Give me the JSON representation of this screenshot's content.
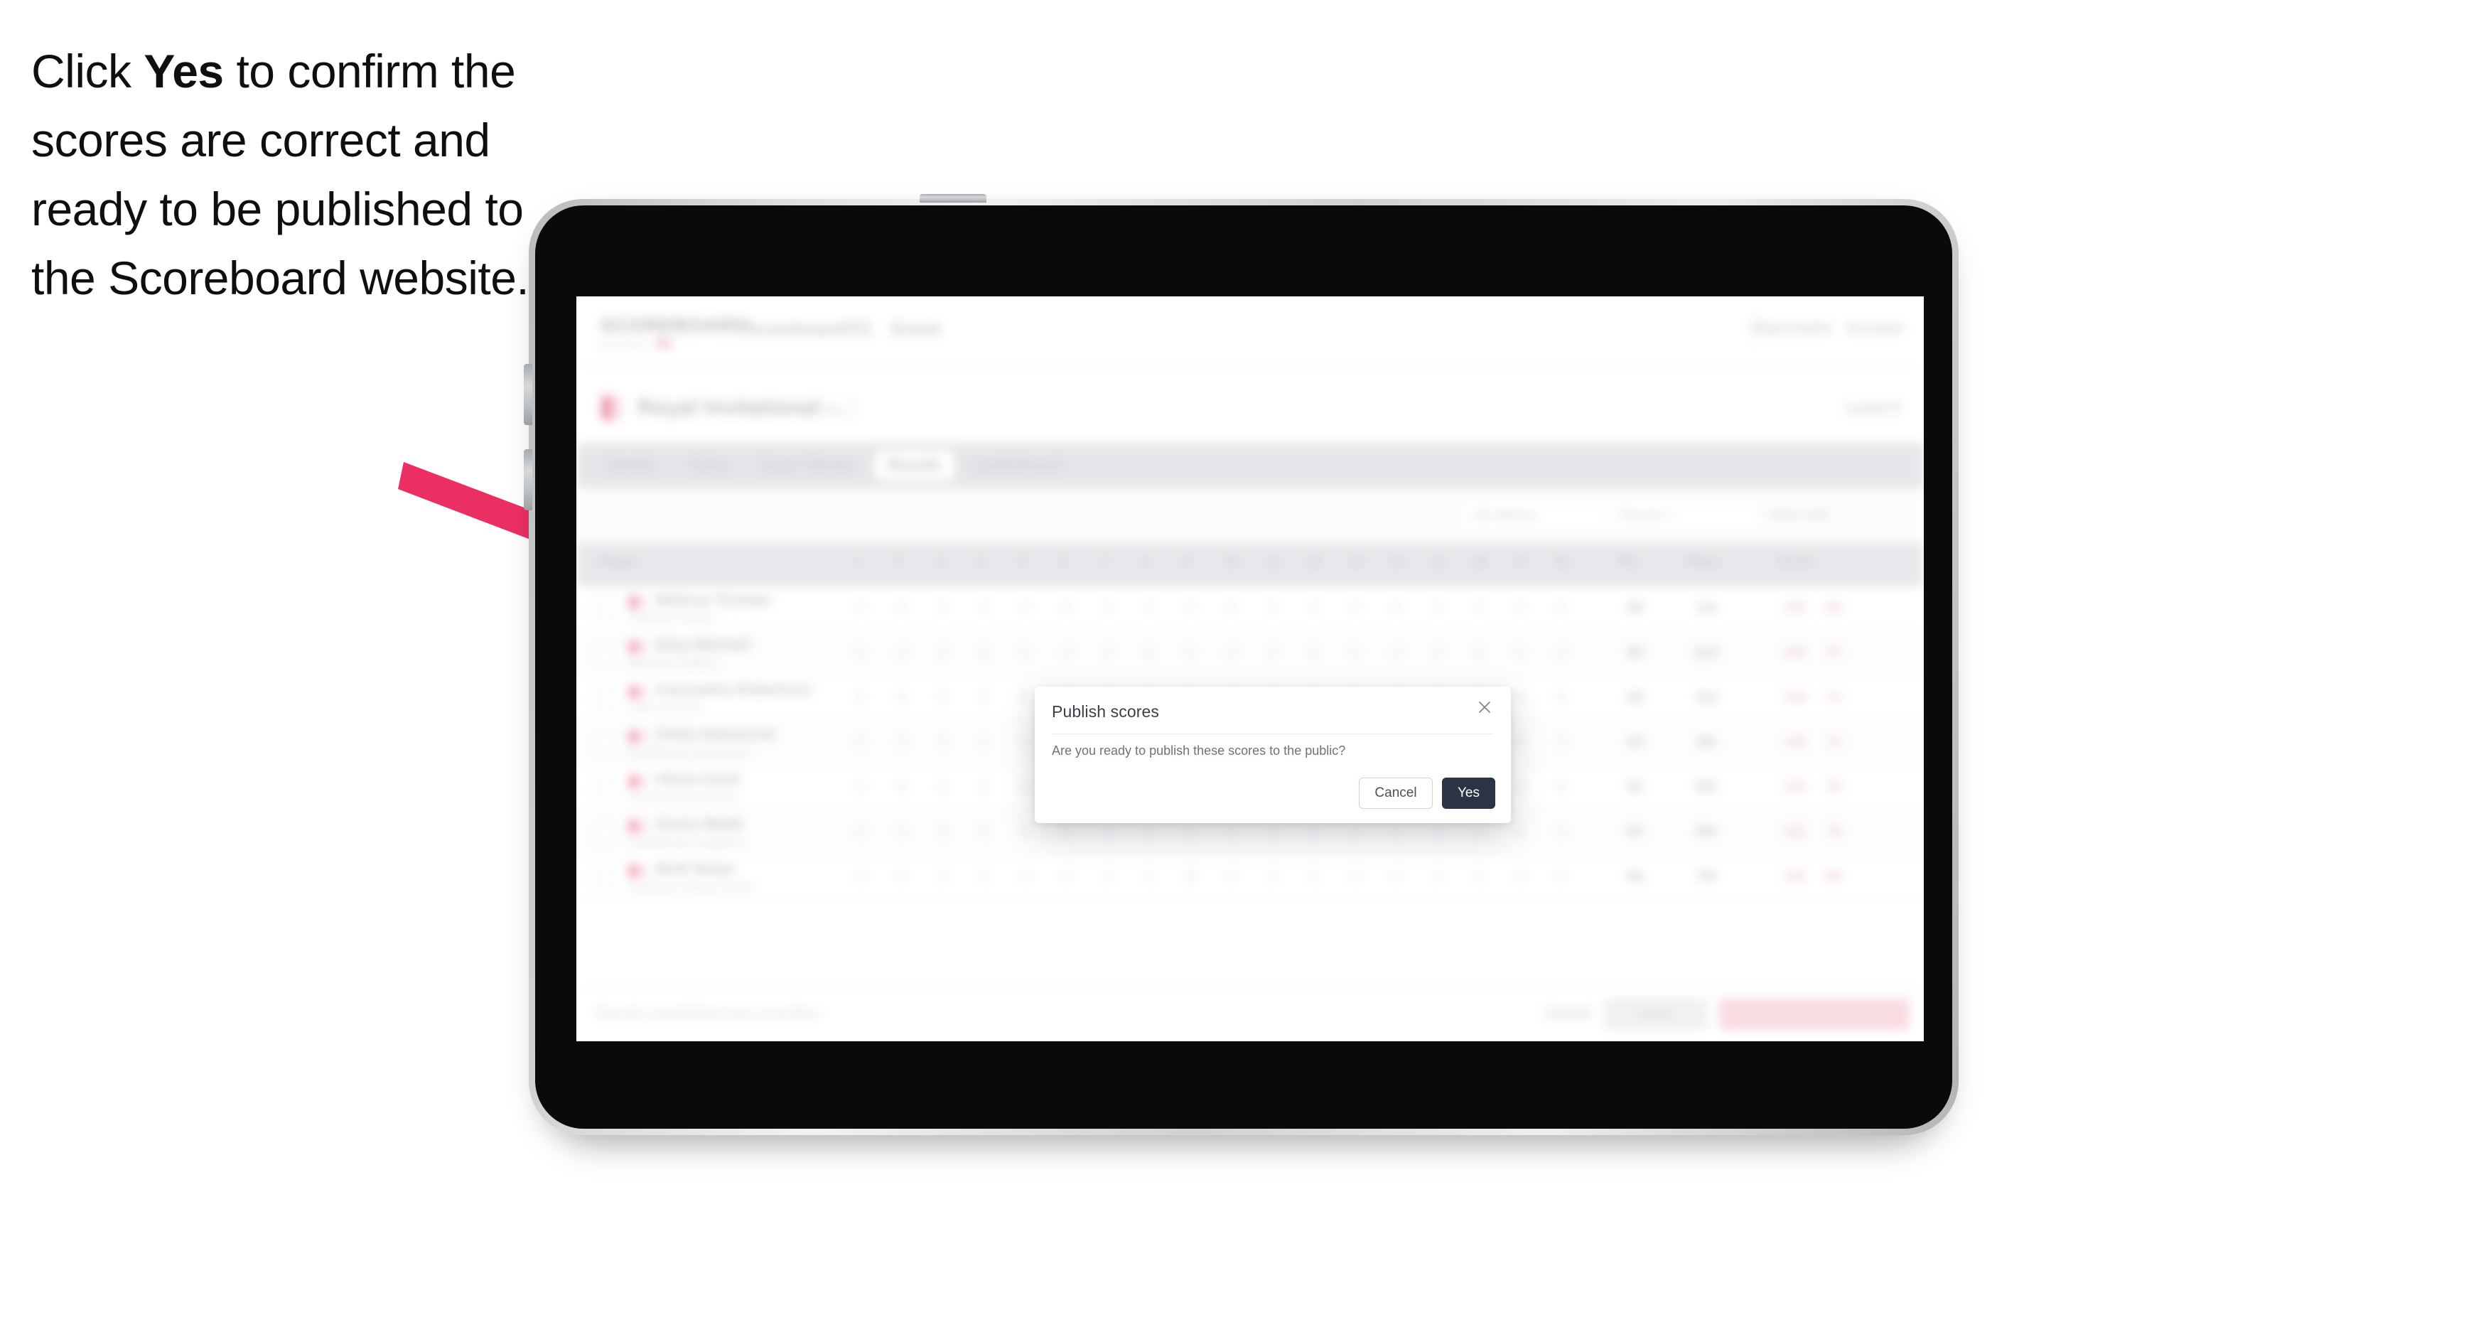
{
  "caption": {
    "before": "Click ",
    "emphasis": "Yes",
    "after": " to confirm the scores are correct and ready to be published to the Scoreboard website."
  },
  "colors": {
    "arrow": "#ec2f62",
    "primary_button": "#2b3445",
    "accent_pink": "#ef4069",
    "device_bezel": "#0a0a0a",
    "device_frame": "#cfd1d3"
  },
  "modal": {
    "title": "Publish scores",
    "body": "Are you ready to publish these scores to the public?",
    "close_icon": "close-icon",
    "cancel_label": "Cancel",
    "confirm_label": "Yes"
  },
  "app": {
    "logo": "SCOREBOARD",
    "logo_sub": "by Sportity",
    "nav": [
      "Scoreboard/V3",
      "Event"
    ],
    "nav_right": [
      "Help Centre",
      "Account"
    ],
    "breadcrumb": "Event dashboard",
    "event": {
      "title": "Royal Invitational",
      "subtitle": "Day 2",
      "status": "Level 3"
    },
    "tabs": [
      {
        "label": "Details",
        "active": false
      },
      {
        "label": "Entry",
        "active": false
      },
      {
        "label": "Score Sheets",
        "active": false
      },
      {
        "label": "Results",
        "active": true
      },
      {
        "label": "Leaderboard",
        "active": false
      }
    ],
    "filters": [
      "All classes",
      "Round 1",
      "Team only"
    ],
    "table": {
      "columns": [
        "Player",
        "1",
        "2",
        "3",
        "4",
        "5",
        "6",
        "7",
        "8",
        "9",
        "10",
        "11",
        "12",
        "13",
        "14",
        "15",
        "16",
        "17",
        "18",
        "Pts",
        "Place",
        "Score"
      ],
      "rows": [
        {
          "name": "Melissa Thomas",
          "club": "Oakmont Riders",
          "cells": [
            "4",
            "4",
            "4",
            "4",
            "4",
            "4",
            "4",
            "4",
            "4",
            "4",
            "4",
            "4",
            "4",
            "4",
            "4",
            "4",
            "4",
            "4"
          ],
          "pts": "68",
          "place": "1st",
          "score": "142",
          "total": "68"
        },
        {
          "name": "Eliza Mitchell",
          "club": "Wexford Stables",
          "cells": [
            "4",
            "4",
            "4",
            "4",
            "4",
            "4",
            "4",
            "4",
            "4",
            "4",
            "4",
            "4",
            "4",
            "4",
            "4",
            "4",
            "4",
            "4"
          ],
          "pts": "68",
          "place": "2nd",
          "score": "144",
          "total": "70"
        },
        {
          "name": "Cassandra Robertson",
          "club": "Hillcrest Club",
          "cells": [
            "4",
            "4",
            "4",
            "4",
            "4",
            "4",
            "4",
            "4",
            "4",
            "4",
            "4",
            "4",
            "4",
            "4",
            "4",
            "4",
            "4",
            "4"
          ],
          "pts": "66",
          "place": "3rd",
          "score": "146",
          "total": "72"
        },
        {
          "name": "Chloe Hammond",
          "club": "Northbrook Equestrian",
          "cells": [
            "4",
            "4",
            "4",
            "4",
            "4",
            "4",
            "4",
            "4",
            "8",
            "4",
            "4",
            "4",
            "4",
            "4",
            "4",
            "4",
            "4",
            "4"
          ],
          "pts": "64",
          "place": "4th",
          "score": "148",
          "total": "74"
        },
        {
          "name": "Olivia Grant",
          "club": "Ravenswood Riding",
          "cells": [
            "4",
            "4",
            "4",
            "4",
            "4",
            "4",
            "4",
            "4",
            "8",
            "4",
            "4",
            "4",
            "4",
            "4",
            "4",
            "4",
            "4",
            "4"
          ],
          "pts": "62",
          "place": "5th",
          "score": "150",
          "total": "76"
        },
        {
          "name": "Grace Webb",
          "club": "Silverbrook Academy",
          "cells": [
            "4",
            "4",
            "4",
            "4",
            "4",
            "4",
            "4",
            "4",
            "8",
            "4",
            "4",
            "4",
            "4",
            "4",
            "4",
            "4",
            "4",
            "4"
          ],
          "pts": "60",
          "place": "6th",
          "score": "152",
          "total": "78"
        },
        {
          "name": "Beth Nolan",
          "club": "Lakeside Riding Centre",
          "cells": [
            "4",
            "4",
            "4",
            "4",
            "4",
            "4",
            "4",
            "4",
            "8",
            "4",
            "4",
            "4",
            "4",
            "4",
            "4",
            "4",
            "4",
            "4"
          ],
          "pts": "58",
          "place": "7th",
          "score": "154",
          "total": "80"
        }
      ]
    },
    "footer": {
      "note": "Results unpublished and unverified",
      "link": "Cancel",
      "secondary_button": "Save",
      "primary_button": "Publish and notify riders"
    }
  }
}
